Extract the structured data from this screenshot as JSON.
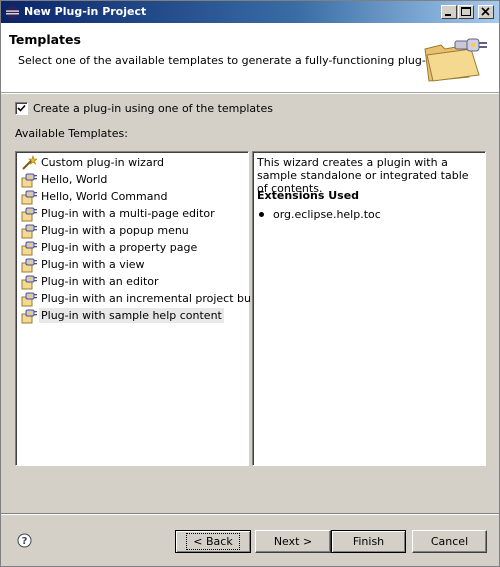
{
  "window": {
    "title": "New Plug-in Project"
  },
  "header": {
    "heading": "Templates",
    "description": "Select one of the available templates to generate a fully-functioning plug-in."
  },
  "use_template": {
    "label": "Create a plug-in using one of the templates",
    "checked": true
  },
  "available_label": "Available Templates:",
  "templates": [
    {
      "label": "Custom plug-in wizard",
      "icon": "wand-icon"
    },
    {
      "label": "Hello, World",
      "icon": "plugin-template-icon"
    },
    {
      "label": "Hello, World Command",
      "icon": "plugin-template-icon"
    },
    {
      "label": "Plug-in with a multi-page editor",
      "icon": "plugin-template-icon"
    },
    {
      "label": "Plug-in with a popup menu",
      "icon": "plugin-template-icon"
    },
    {
      "label": "Plug-in with a property page",
      "icon": "plugin-template-icon"
    },
    {
      "label": "Plug-in with a view",
      "icon": "plugin-template-icon"
    },
    {
      "label": "Plug-in with an editor",
      "icon": "plugin-template-icon"
    },
    {
      "label": "Plug-in with an incremental project builder",
      "icon": "plugin-template-icon"
    },
    {
      "label": "Plug-in with sample help content",
      "icon": "plugin-template-icon",
      "selected": true
    }
  ],
  "details": {
    "description": "This wizard creates a plugin with a sample standalone or integrated table of contents.",
    "extensions_title": "Extensions Used",
    "extensions": [
      "org.eclipse.help.toc"
    ]
  },
  "buttons": {
    "back": "< Back",
    "next": "Next >",
    "finish": "Finish",
    "cancel": "Cancel"
  }
}
